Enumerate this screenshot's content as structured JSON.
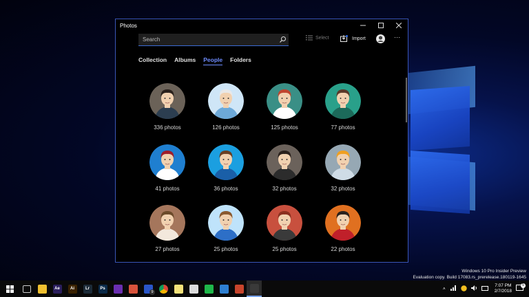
{
  "window": {
    "title": "Photos",
    "search_placeholder": "Search",
    "select_label": "Select",
    "import_label": "Import",
    "more_label": "···"
  },
  "tabs": [
    {
      "label": "Collection"
    },
    {
      "label": "Albums"
    },
    {
      "label": "People",
      "active": true
    },
    {
      "label": "Folders"
    }
  ],
  "people": [
    {
      "count": "336 photos",
      "bg": "#6b6258",
      "skin": "#f1d1b0",
      "hair": "#2a211c",
      "shirt": "#2c3e50"
    },
    {
      "count": "126 photos",
      "bg": "#cfe6f7",
      "skin": "#f1d1b0",
      "hair": "#e8e8e8",
      "shirt": "#6da9d8"
    },
    {
      "count": "125 photos",
      "bg": "#3a8f86",
      "skin": "#f1d1b0",
      "hair": "#c0452f",
      "shirt": "#ffffff"
    },
    {
      "count": "77 photos",
      "bg": "#29a08a",
      "skin": "#f1d1b0",
      "hair": "#5a3a2a",
      "shirt": "#1c6a5a"
    },
    {
      "count": "41 photos",
      "bg": "#1f7fd0",
      "skin": "#f1d1b0",
      "hair": "#a01d2b",
      "shirt": "#ffffff"
    },
    {
      "count": "36 photos",
      "bg": "#1b9fe0",
      "skin": "#f1d1b0",
      "hair": "#6b3f22",
      "shirt": "#1a5fa8"
    },
    {
      "count": "32 photos",
      "bg": "#6b625b",
      "skin": "#f1d1b0",
      "hair": "#2a211c",
      "shirt": "#2c2c2c"
    },
    {
      "count": "32 photos",
      "bg": "#96a8b4",
      "skin": "#f1d1b0",
      "hair": "#f0a020",
      "shirt": "#cfdce6"
    },
    {
      "count": "27 photos",
      "bg": "#a5765c",
      "skin": "#f1d1b0",
      "hair": "#6b4a2a",
      "shirt": "#f3e8dc"
    },
    {
      "count": "25 photos",
      "bg": "#bfe3fb",
      "skin": "#f1d1b0",
      "hair": "#8a5a30",
      "shirt": "#2d6fc7"
    },
    {
      "count": "25 photos",
      "bg": "#c8503e",
      "skin": "#f1d1b0",
      "hair": "#8a3020",
      "shirt": "#3a3a3a"
    },
    {
      "count": "22 photos",
      "bg": "#e07020",
      "skin": "#f1d1b0",
      "hair": "#2a211c",
      "shirt": "#c0202a"
    }
  ],
  "watermark": {
    "line1": "Windows 10 Pro Insider Preview",
    "line2": "Evaluation copy. Build 17083.rs_prerelease.180119-1645"
  },
  "taskbar": {
    "apps": [
      {
        "icon": "task-view-icon",
        "color": "#0a0a0a",
        "text": ""
      },
      {
        "icon": "file-explorer-icon",
        "color": "#f0c030",
        "text": ""
      },
      {
        "icon": "after-effects-icon",
        "color": "#2a1e5c",
        "text": "Ae"
      },
      {
        "icon": "illustrator-icon",
        "color": "#3a2200",
        "text": "Ai"
      },
      {
        "icon": "lightroom-icon",
        "color": "#1c2b38",
        "text": "Lr"
      },
      {
        "icon": "photoshop-icon",
        "color": "#0b2a48",
        "text": "Ps"
      },
      {
        "icon": "visual-studio-icon",
        "color": "#6a2fb0",
        "text": ""
      },
      {
        "icon": "power-app-icon",
        "color": "#d9543c",
        "text": ""
      },
      {
        "icon": "mail-icon",
        "color": "#2a56c8",
        "text": ""
      },
      {
        "icon": "chrome-icon",
        "color": "#d9a020",
        "text": ""
      },
      {
        "icon": "sticky-notes-icon",
        "color": "#f4e27a",
        "text": ""
      },
      {
        "icon": "printer-icon",
        "color": "#dcdcdc",
        "text": ""
      },
      {
        "icon": "line-icon",
        "color": "#1fb84a",
        "text": ""
      },
      {
        "icon": "remote-desktop-icon",
        "color": "#2e7fd0",
        "text": ""
      },
      {
        "icon": "powerpoint-icon",
        "color": "#c8452c",
        "text": ""
      },
      {
        "icon": "photos-app-icon",
        "color": "#3a3a3a",
        "text": ""
      }
    ],
    "badge": "9",
    "time": "7:07 PM",
    "date": "2/7/2018",
    "notification_count": "5"
  }
}
